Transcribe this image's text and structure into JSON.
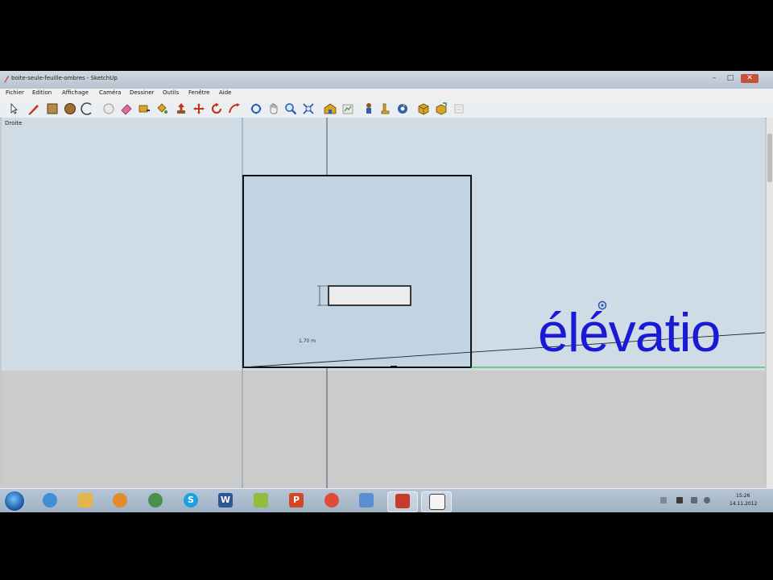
{
  "window": {
    "title": "boite-seule-feuille-ombres - SketchUp",
    "minimize_glyph": "–",
    "maximize_glyph": "□",
    "close_glyph": "✕"
  },
  "menu": {
    "items": [
      "Fichier",
      "Edition",
      "Affichage",
      "Caméra",
      "Dessiner",
      "Outils",
      "Fenêtre",
      "Aide"
    ]
  },
  "toolbar": {
    "tools": [
      {
        "name": "select-tool-icon"
      },
      {
        "name": "pencil-tool-icon"
      },
      {
        "name": "rectangle-tool-icon"
      },
      {
        "name": "circle-tool-icon"
      },
      {
        "name": "arc-tool-icon"
      },
      {
        "name": "make-component-icon"
      },
      {
        "name": "eraser-tool-icon"
      },
      {
        "name": "tape-measure-icon"
      },
      {
        "name": "paint-bucket-icon"
      },
      {
        "name": "push-pull-icon"
      },
      {
        "name": "move-tool-icon"
      },
      {
        "name": "rotate-tool-icon"
      },
      {
        "name": "follow-me-icon"
      },
      {
        "name": "orbit-tool-icon"
      },
      {
        "name": "pan-tool-icon"
      },
      {
        "name": "zoom-tool-icon"
      },
      {
        "name": "zoom-extents-icon"
      },
      {
        "name": "warehouse-icon"
      },
      {
        "name": "share-model-icon"
      },
      {
        "name": "position-camera-icon"
      },
      {
        "name": "walk-tool-icon"
      },
      {
        "name": "look-around-icon"
      },
      {
        "name": "component-icon"
      },
      {
        "name": "extension-icon"
      },
      {
        "name": "ruby-console-icon"
      }
    ],
    "colors": {
      "red": "#c8321e",
      "brown": "#8b5a2b",
      "blue": "#2a5fb3",
      "yellow": "#d9a520",
      "green": "#3e8e3a",
      "grey": "#9a9a9a"
    }
  },
  "viewport": {
    "view_label": "Droite",
    "elevation_text": "élévatio",
    "dimension_value": "1,70 m",
    "colors": {
      "sky": "#cfdce6",
      "ground": "#cbcbcb",
      "face": "#c0d4e2",
      "text": "#1a1ad6",
      "green_axis": "#3cbf3c"
    }
  },
  "taskbar": {
    "apps": [
      {
        "name": "internet-explorer-icon",
        "color": "#3f8ed6"
      },
      {
        "name": "explorer-folder-icon",
        "color": "#e3b54a"
      },
      {
        "name": "media-player-icon",
        "color": "#e58a2c"
      },
      {
        "name": "network-icon",
        "color": "#4a8f4f"
      },
      {
        "name": "skype-icon",
        "color": "#1ba0e0",
        "glyph": "S"
      },
      {
        "name": "word-icon",
        "color": "#2b5797",
        "glyph": "W"
      },
      {
        "name": "sketch-pen-icon",
        "color": "#8fbf3c"
      },
      {
        "name": "powerpoint-icon",
        "color": "#d24726",
        "glyph": "P"
      },
      {
        "name": "chrome-icon",
        "color": "#e04a3a"
      },
      {
        "name": "users-icon",
        "color": "#5a8fd0"
      },
      {
        "name": "sketchup-icon",
        "color": "#c73b2b",
        "active": true
      },
      {
        "name": "window-icon",
        "color": "#f4f4f4",
        "active": true
      }
    ],
    "clock_time": "15:26",
    "clock_date": "14.11.2012"
  }
}
